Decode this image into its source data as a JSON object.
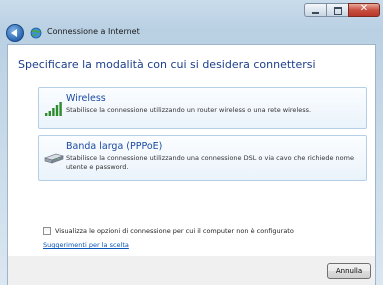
{
  "window": {
    "title": "Connessione a Internet",
    "icons": {
      "back": "back-arrow-icon",
      "app": "network-globe-icon"
    }
  },
  "main": {
    "heading": "Specificare la modalità con cui si desidera connettersi",
    "options": [
      {
        "title": "Wireless",
        "description": "Stabilisce la connessione utilizzando un router wireless o una rete wireless.",
        "icon": "wireless-signal-bars-icon"
      },
      {
        "title": "Banda larga (PPPoE)",
        "description": "Stabilisce la connessione utilizzando una connessione DSL o via cavo che richiede nome utente e password.",
        "icon": "broadband-modem-icon"
      }
    ],
    "show_unconfigured_checkbox": {
      "label": "Visualizza le opzioni di connessione per cui il computer non è configurato",
      "checked": false
    },
    "help_link": "Suggerimenti per la scelta"
  },
  "footer": {
    "cancel_label": "Annulla"
  },
  "colors": {
    "heading": "#1c3e8c",
    "option_title": "#1a4aa0",
    "link": "#0a55b8",
    "close_button": "#c85041",
    "wireless_bars": "#2e8b2e"
  }
}
